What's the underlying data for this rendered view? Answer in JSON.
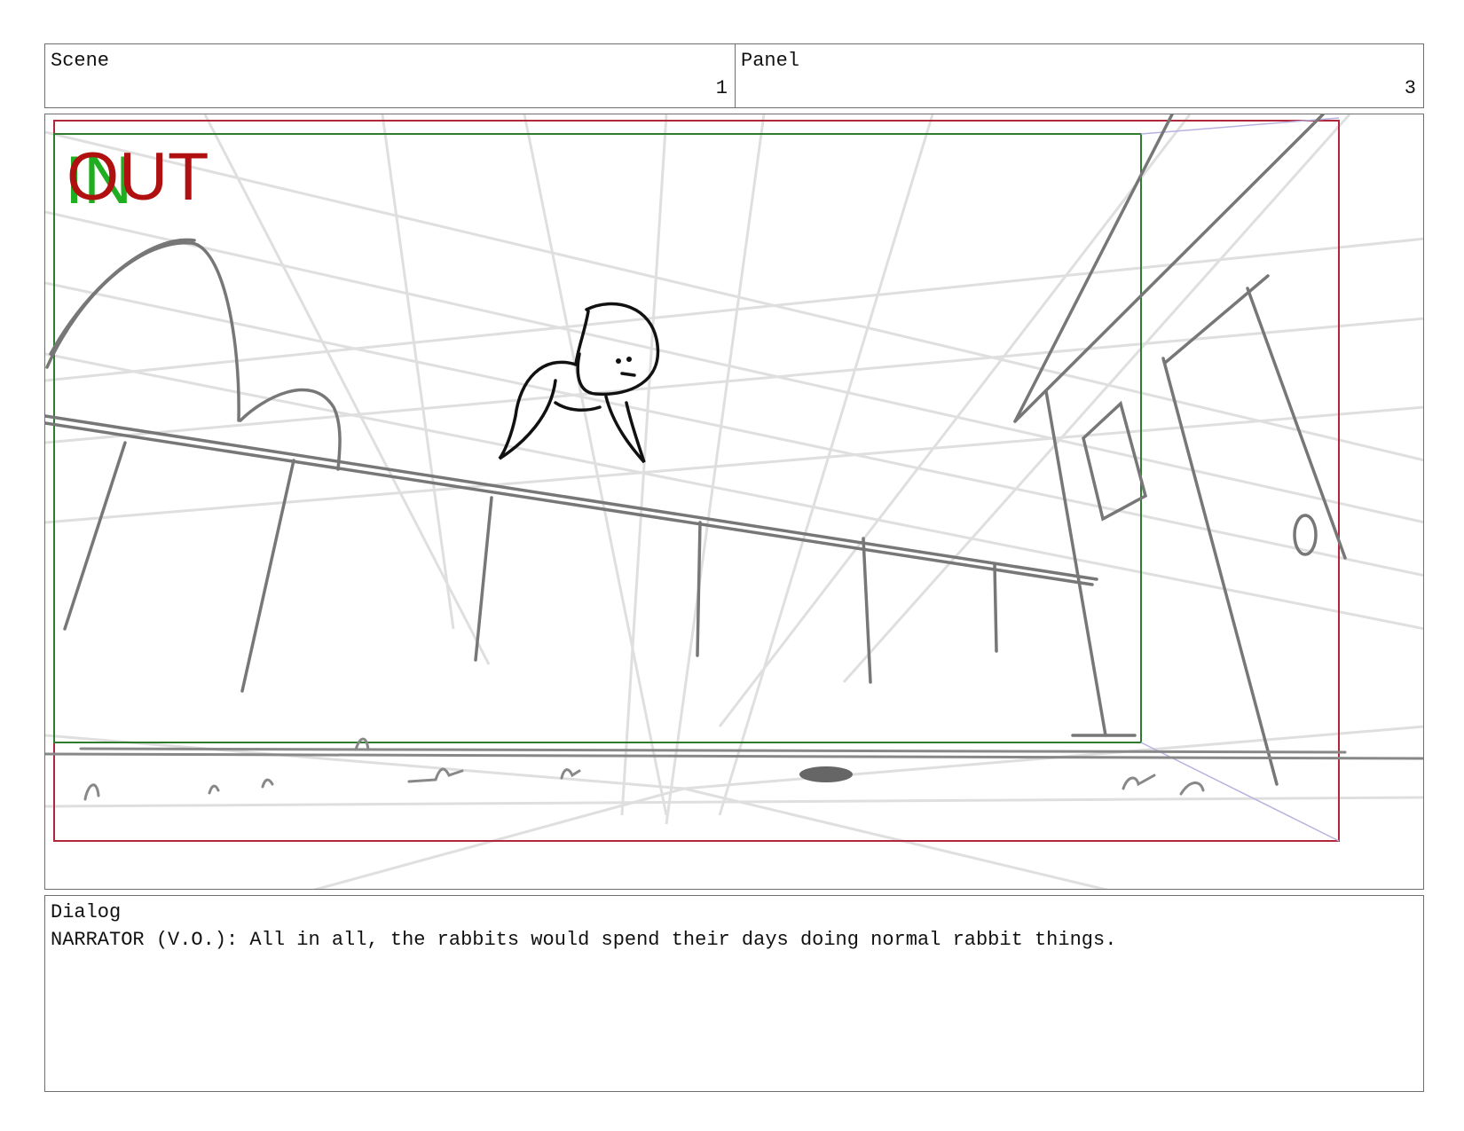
{
  "header": {
    "scene_label": "Scene",
    "scene_number": "1",
    "panel_label": "Panel",
    "panel_number": "3"
  },
  "frame": {
    "marker_in": "IN",
    "marker_out": "OUT",
    "colors": {
      "out_marker": "#b01010",
      "in_marker": "#1fae1f",
      "safe_area": "#2e7d2e",
      "frame_border": "#b0263a",
      "perspective_grid": "#dcdcdc",
      "sketch": "#777777",
      "character": "#111111"
    }
  },
  "dialog": {
    "label": "Dialog",
    "text": "NARRATOR (V.O.): All in all, the rabbits would spend their days doing normal rabbit things."
  }
}
